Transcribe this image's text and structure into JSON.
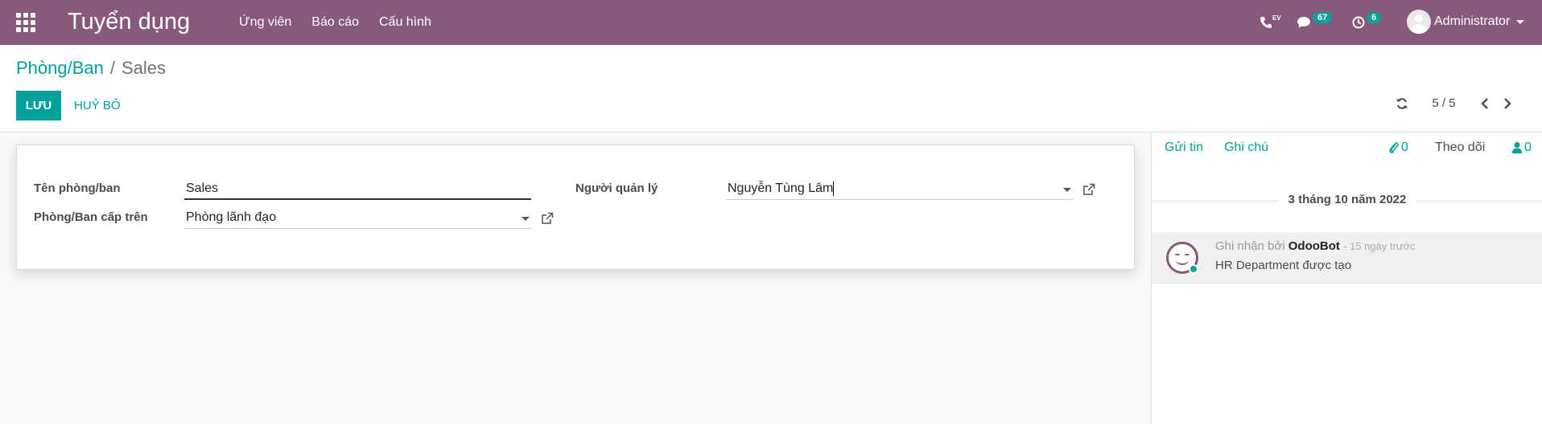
{
  "navbar": {
    "brand": "Tuyển dụng",
    "menu": [
      "Ứng viên",
      "Báo cáo",
      "Cấu hình"
    ],
    "messages_count": "67",
    "activities_count": "6",
    "phone_label": "EV",
    "user_name": "Administrator"
  },
  "breadcrumb": {
    "parent": "Phòng/Ban",
    "separator": "/",
    "current": "Sales"
  },
  "actions": {
    "save": "LƯU",
    "discard": "HUỶ BỎ"
  },
  "pager": {
    "value": "5 / 5"
  },
  "form": {
    "name_label": "Tên phòng/ban",
    "name_value": "Sales",
    "parent_label": "Phòng/Ban cấp trên",
    "parent_value": "Phòng lãnh đạo",
    "manager_label": "Người quản lý",
    "manager_value": "Nguyễn Tùng Lâm"
  },
  "chatter": {
    "send_message": "Gửi tin",
    "log_note": "Ghi chú",
    "attachments_count": "0",
    "follow": "Theo dõi",
    "followers_count": "0",
    "date_separator": "3 tháng 10 năm 2022",
    "message": {
      "prefix": "Ghi nhận bởi",
      "author": "OdooBot",
      "time": "- 15 ngày trước",
      "body": "HR Department được tạo"
    }
  },
  "colors": {
    "brand": "#875a7b",
    "accent": "#00a09d"
  }
}
